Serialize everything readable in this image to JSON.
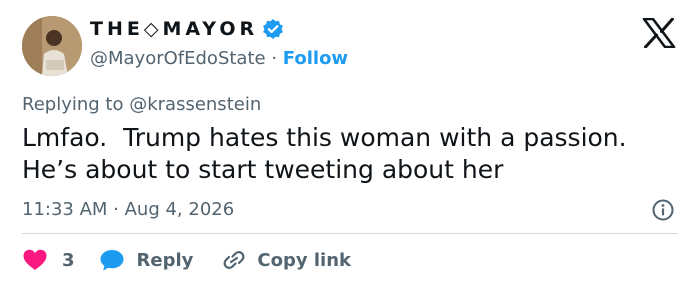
{
  "author": {
    "display_name": "THE◇MAYOR",
    "handle": "@MayorOfEdoState",
    "separator": "·",
    "follow_label": "Follow"
  },
  "tweet": {
    "replying_prefix": "Replying to",
    "replying_to": "@krassenstein",
    "text_line1": "Lmfao.  Trump hates this woman with a passion.",
    "text_line2": "He’s about to start tweeting about her",
    "timestamp": "11:33 AM · Aug 4, 2026"
  },
  "actions": {
    "like_count": "3",
    "reply_label": "Reply",
    "copy_label": "Copy link"
  },
  "colors": {
    "accent": "#1d9bf0",
    "like": "#f91880",
    "muted": "#536471",
    "text": "#0f1419"
  },
  "icons": [
    "verified-badge-icon",
    "x-logo-icon",
    "info-icon",
    "heart-icon",
    "reply-bubble-icon",
    "link-icon"
  ]
}
